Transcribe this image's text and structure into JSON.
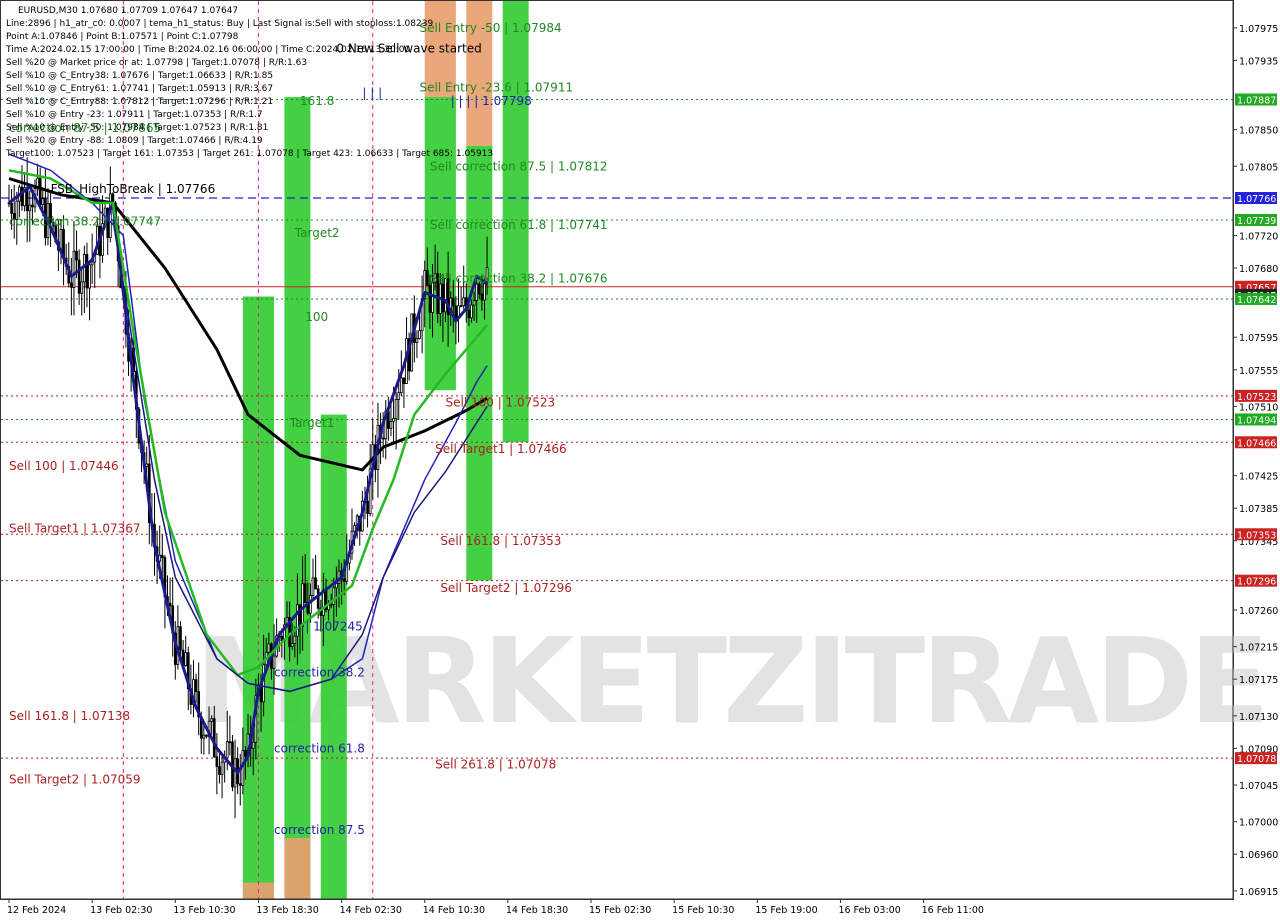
{
  "chart_data": {
    "type": "candlestick",
    "symbol_line": "EURUSD,M30  1.07680 1.07709 1.07647 1.07647",
    "info_lines": [
      "Line:2896  |  h1_atr_c0: 0.0007  |  tema_h1_status: Buy  |  Last Signal is:Sell with stoploss:1.08239",
      "Point A:1.07846  |  Point B:1.07571  |  Point C:1.07798",
      "Time A:2024.02.15 17:00:00  |  Time B:2024.02.16 06:00:00  |  Time C:2024.02.16 13:30:00",
      "Sell %20 @ Market price or at: 1.07798  |  Target:1.07078  |  R/R:1.63",
      "Sell %10 @ C_Entry38: 1.07676  |  Target:1.06633  |  R/R:1.85",
      "Sell %10 @ C_Entry61: 1.07741  |  Target:1.05913  |  R/R:3.67",
      "Sell %10 @ C_Entry88: 1.07812  |  Target:1.07296  |  R/R:1.21",
      "Sell %10 @ Entry -23: 1.07911  |  Target:1.07353  |  R/R:1.7",
      "Sell %10 @ Entry -50: 1.07984  |  Target:1.07523  |  R/R:1.81",
      "Sell %20 @ Entry -88: 1.0809  |  Target:1.07466  |  R/R:4.19",
      "Target100: 1.07523  |  Target 161: 1.07353  |  Target 261: 1.07078  |  Target 423: 1.06633  |  Target 685: 1.05913"
    ],
    "y_axis": {
      "range": [
        1.06905,
        1.08008
      ],
      "ticks": [
        "1.07975",
        "1.07935",
        "1.07850",
        "1.07805",
        "1.07720",
        "1.07680",
        "1.07595",
        "1.07555",
        "1.07510",
        "1.07425",
        "1.07385",
        "1.07345",
        "1.07260",
        "1.07215",
        "1.07175",
        "1.07130",
        "1.07090",
        "1.07045",
        "1.07000",
        "1.06960",
        "1.06915"
      ]
    },
    "x_axis": {
      "labels": [
        "12 Feb 2024",
        "13 Feb 02:30",
        "13 Feb 10:30",
        "13 Feb 18:30",
        "14 Feb 02:30",
        "14 Feb 10:30",
        "14 Feb 18:30",
        "15 Feb 02:30",
        "15 Feb 10:30",
        "15 Feb 19:00",
        "16 Feb 03:00",
        "16 Feb 11:00"
      ],
      "bar_range": [
        0,
        234
      ],
      "label_bars": [
        0,
        16,
        32,
        48,
        64,
        80,
        96,
        112,
        128,
        144,
        160,
        176
      ]
    },
    "price_badges": [
      {
        "value": "1.07887",
        "price": 1.07887,
        "color": "#22aa22"
      },
      {
        "value": "1.07766",
        "price": 1.07766,
        "color": "#2222dd"
      },
      {
        "value": "1.07739",
        "price": 1.07739,
        "color": "#22aa22"
      },
      {
        "value": "1.07657",
        "price": 1.07657,
        "color": "#cc2222"
      },
      {
        "value": "1.07647",
        "price": 1.07647,
        "color": "#222222"
      },
      {
        "value": "1.07642",
        "price": 1.07642,
        "color": "#22aa22"
      },
      {
        "value": "1.07523",
        "price": 1.07523,
        "color": "#cc2222"
      },
      {
        "value": "1.07494",
        "price": 1.07494,
        "color": "#22aa22"
      },
      {
        "value": "1.07466",
        "price": 1.07466,
        "color": "#cc2222"
      },
      {
        "value": "1.07353",
        "price": 1.07353,
        "color": "#cc2222"
      },
      {
        "value": "1.07296",
        "price": 1.07296,
        "color": "#cc2222"
      },
      {
        "value": "1.07078",
        "price": 1.07078,
        "color": "#cc2222"
      }
    ],
    "horizontal_levels": [
      {
        "price": 1.07887,
        "color": "#228822",
        "style": "dotted"
      },
      {
        "price": 1.07766,
        "color": "#2222cc",
        "style": "dashed"
      },
      {
        "price": 1.07739,
        "color": "#228822",
        "style": "dotted"
      },
      {
        "price": 1.07657,
        "color": "#cc2222",
        "style": "solid"
      },
      {
        "price": 1.07642,
        "color": "#228822",
        "style": "dotted"
      },
      {
        "price": 1.07523,
        "color": "#aa2222",
        "style": "dotted"
      },
      {
        "price": 1.07494,
        "color": "#228822",
        "style": "dotted"
      },
      {
        "price": 1.07466,
        "color": "#aa2222",
        "style": "dotted"
      },
      {
        "price": 1.07353,
        "color": "#aa2222",
        "style": "dotted"
      },
      {
        "price": 1.07296,
        "color": "#aa2222",
        "style": "dotted"
      },
      {
        "price": 1.07078,
        "color": "#aa2222",
        "style": "dotted"
      }
    ],
    "vertical_markers": [
      {
        "bar": 22,
        "color": "#dd2299"
      },
      {
        "bar": 48,
        "color": "#dd2299"
      },
      {
        "bar": 70,
        "color": "#dd2299"
      }
    ],
    "zones": [
      {
        "bar_from": 45,
        "bar_to": 51,
        "price_top": 1.07645,
        "price_bottom": 1.06905,
        "color": "#33cc33"
      },
      {
        "bar_from": 45,
        "bar_to": 51,
        "price_top": 1.06925,
        "price_bottom": 1.06905,
        "color": "#e8a070"
      },
      {
        "bar_from": 53,
        "bar_to": 58,
        "price_top": 1.0789,
        "price_bottom": 1.06905,
        "color": "#33cc33"
      },
      {
        "bar_from": 53,
        "bar_to": 58,
        "price_top": 1.0698,
        "price_bottom": 1.06905,
        "color": "#e8a070"
      },
      {
        "bar_from": 60,
        "bar_to": 65,
        "price_top": 1.075,
        "price_bottom": 1.06905,
        "color": "#33cc33"
      },
      {
        "bar_from": 80,
        "bar_to": 86,
        "price_top": 1.08008,
        "price_bottom": 1.0789,
        "color": "#e8a070"
      },
      {
        "bar_from": 80,
        "bar_to": 86,
        "price_top": 1.0789,
        "price_bottom": 1.0753,
        "color": "#33cc33"
      },
      {
        "bar_from": 88,
        "bar_to": 93,
        "price_top": 1.08008,
        "price_bottom": 1.0783,
        "color": "#e8a070"
      },
      {
        "bar_from": 88,
        "bar_to": 93,
        "price_top": 1.0783,
        "price_bottom": 1.07296,
        "color": "#33cc33"
      },
      {
        "bar_from": 95,
        "bar_to": 100,
        "price_top": 1.08008,
        "price_bottom": 1.07466,
        "color": "#33cc33"
      }
    ],
    "annotations": [
      {
        "text": "0 New Sell wave started",
        "bar": 63,
        "price": 1.07945,
        "color": "#000000"
      },
      {
        "text": "Sell Entry -50 | 1.07984",
        "bar": 79,
        "price": 1.0797,
        "color": "#228822"
      },
      {
        "text": "Sell Entry -23.6 | 1.07911",
        "bar": 79,
        "price": 1.07897,
        "color": "#228822"
      },
      {
        "text": "| | | | 1.07798",
        "bar": 85,
        "price": 1.0788,
        "color": "#2222aa"
      },
      {
        "text": "Sell correction 87.5 | 1.07812",
        "bar": 81,
        "price": 1.078,
        "color": "#228822"
      },
      {
        "text": "Sell correction 61.8 | 1.07741",
        "bar": 81,
        "price": 1.07728,
        "color": "#228822"
      },
      {
        "text": "Sell correction 38.2 | 1.07676",
        "bar": 81,
        "price": 1.07662,
        "color": "#228822"
      },
      {
        "text": "Sell 100 | 1.07523",
        "bar": 84,
        "price": 1.0751,
        "color": "#aa2222"
      },
      {
        "text": "Sell Target1 | 1.07466",
        "bar": 82,
        "price": 1.07453,
        "color": "#aa2222"
      },
      {
        "text": "Sell 161.8 | 1.07353",
        "bar": 83,
        "price": 1.0734,
        "color": "#aa2222"
      },
      {
        "text": "Sell Target2 | 1.07296",
        "bar": 83,
        "price": 1.07282,
        "color": "#aa2222"
      },
      {
        "text": "Sell 261.8 | 1.07078",
        "bar": 82,
        "price": 1.07065,
        "color": "#aa2222"
      },
      {
        "text": "Sell 100 | 1.07446",
        "bar": 0,
        "price": 1.07432,
        "color": "#aa2222"
      },
      {
        "text": "Sell Target1 | 1.07367",
        "bar": 0,
        "price": 1.07355,
        "color": "#aa2222"
      },
      {
        "text": "Sell 161.8 | 1.07138",
        "bar": 0,
        "price": 1.07125,
        "color": "#aa2222"
      },
      {
        "text": "Sell Target2 | 1.07059",
        "bar": 0,
        "price": 1.07047,
        "color": "#aa2222"
      },
      {
        "text": "161.8",
        "bar": 56,
        "price": 1.0788,
        "color": "#228822"
      },
      {
        "text": "Target2",
        "bar": 55,
        "price": 1.07718,
        "color": "#228822"
      },
      {
        "text": "100",
        "bar": 57,
        "price": 1.07615,
        "color": "#228822"
      },
      {
        "text": "Target1",
        "bar": 54,
        "price": 1.07485,
        "color": "#228822"
      },
      {
        "text": "| | |",
        "bar": 68,
        "price": 1.0789,
        "color": "#2222aa"
      },
      {
        "text": "| | | 1.07245",
        "bar": 54,
        "price": 1.07235,
        "color": "#2222aa"
      },
      {
        "text": "correction 38.2",
        "bar": 51,
        "price": 1.07178,
        "color": "#2222aa"
      },
      {
        "text": "correction 61.8",
        "bar": 51,
        "price": 1.07085,
        "color": "#2222aa"
      },
      {
        "text": "correction 87.5",
        "bar": 51,
        "price": 1.06985,
        "color": "#2222aa"
      },
      {
        "text": "correction 87.5 | 1.07865",
        "bar": 0,
        "price": 1.07847,
        "color": "#228822"
      },
      {
        "text": "correction 38.2 | 1.07747",
        "bar": 0,
        "price": 1.07732,
        "color": "#228822"
      },
      {
        "text": "FSB_HighToBreak | 1.07766",
        "bar": 8,
        "price": 1.07772,
        "color": "#000000"
      }
    ],
    "watermark": "MARKETZITRADE",
    "series": [
      {
        "key": "black_ma",
        "color": "#000000",
        "width": 3,
        "points": [
          [
            0,
            1.0779
          ],
          [
            10,
            1.0777
          ],
          [
            20,
            1.0776
          ],
          [
            30,
            1.0768
          ],
          [
            40,
            1.0758
          ],
          [
            46,
            1.075
          ],
          [
            56,
            1.0745
          ],
          [
            68,
            1.07432
          ],
          [
            72,
            1.0746
          ],
          [
            80,
            1.0748
          ],
          [
            88,
            1.07505
          ],
          [
            92,
            1.0752
          ]
        ]
      },
      {
        "key": "navy_thick",
        "color": "#1a1a8a",
        "width": 3,
        "points": [
          [
            0,
            1.0776
          ],
          [
            4,
            1.0778
          ],
          [
            8,
            1.0773
          ],
          [
            12,
            1.0767
          ],
          [
            16,
            1.0769
          ],
          [
            20,
            1.0776
          ],
          [
            24,
            1.0754
          ],
          [
            28,
            1.0734
          ],
          [
            32,
            1.0722
          ],
          [
            36,
            1.0714
          ],
          [
            40,
            1.0709
          ],
          [
            44,
            1.0706
          ],
          [
            46,
            1.0708
          ],
          [
            48,
            1.0716
          ],
          [
            52,
            1.0723
          ],
          [
            56,
            1.0726
          ],
          [
            60,
            1.0728
          ],
          [
            64,
            1.073
          ],
          [
            68,
            1.0738
          ],
          [
            72,
            1.0749
          ],
          [
            76,
            1.0756
          ],
          [
            80,
            1.0765
          ],
          [
            84,
            1.0764
          ],
          [
            86,
            1.07615
          ],
          [
            88,
            1.0763
          ],
          [
            90,
            1.0767
          ],
          [
            92,
            1.0766
          ]
        ]
      },
      {
        "key": "blue_thin",
        "color": "#2222bb",
        "width": 1.5,
        "points": [
          [
            0,
            1.0782
          ],
          [
            8,
            1.078
          ],
          [
            16,
            1.0776
          ],
          [
            22,
            1.0772
          ],
          [
            26,
            1.0752
          ],
          [
            32,
            1.0732
          ],
          [
            40,
            1.072
          ],
          [
            46,
            1.0717
          ],
          [
            54,
            1.0716
          ],
          [
            62,
            1.07175
          ],
          [
            68,
            1.072
          ],
          [
            72,
            1.073
          ],
          [
            80,
            1.0742
          ],
          [
            86,
            1.0749
          ],
          [
            90,
            1.0754
          ],
          [
            92,
            1.0756
          ]
        ]
      },
      {
        "key": "green_ma",
        "color": "#22bb22",
        "width": 2.5,
        "points": [
          [
            0,
            1.078
          ],
          [
            8,
            1.0779
          ],
          [
            16,
            1.0776
          ],
          [
            20,
            1.0776
          ],
          [
            24,
            1.076
          ],
          [
            30,
            1.0738
          ],
          [
            38,
            1.0723
          ],
          [
            44,
            1.0718
          ],
          [
            48,
            1.0719
          ],
          [
            54,
            1.0723
          ],
          [
            60,
            1.0726
          ],
          [
            66,
            1.0729
          ],
          [
            70,
            1.0736
          ],
          [
            74,
            1.0742
          ],
          [
            78,
            1.075
          ],
          [
            84,
            1.0755
          ],
          [
            88,
            1.0758
          ],
          [
            92,
            1.0761
          ]
        ]
      },
      {
        "key": "navy_slow",
        "color": "#1a1a7a",
        "width": 1.5,
        "points": [
          [
            20,
            1.0774
          ],
          [
            24,
            1.0758
          ],
          [
            28,
            1.0742
          ],
          [
            32,
            1.073
          ],
          [
            40,
            1.072
          ],
          [
            46,
            1.0717
          ],
          [
            54,
            1.0716
          ],
          [
            62,
            1.07175
          ],
          [
            68,
            1.0723
          ],
          [
            72,
            1.073
          ],
          [
            78,
            1.0738
          ],
          [
            84,
            1.0743
          ],
          [
            90,
            1.0749
          ],
          [
            92,
            1.0751
          ]
        ]
      }
    ]
  }
}
